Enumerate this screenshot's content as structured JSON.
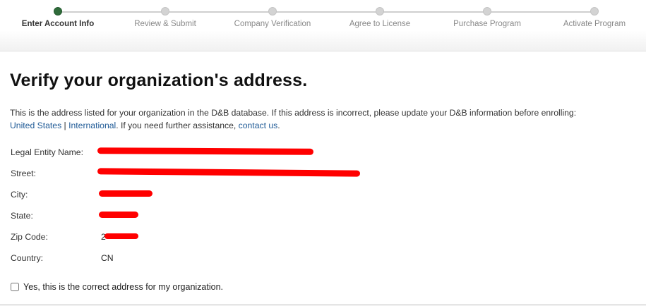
{
  "stepper": {
    "steps": [
      {
        "label": "Enter Account Info",
        "active": true
      },
      {
        "label": "Review & Submit",
        "active": false
      },
      {
        "label": "Company Verification",
        "active": false
      },
      {
        "label": "Agree to License",
        "active": false
      },
      {
        "label": "Purchase Program",
        "active": false
      },
      {
        "label": "Activate Program",
        "active": false
      }
    ]
  },
  "page": {
    "title": "Verify your organization's address.",
    "intro_text": "This is the address listed for your organization in the D&B database. If this address is incorrect, please update your D&B information before enrolling:",
    "link_us": "United States",
    "separator": " | ",
    "link_intl": "International",
    "assist_text": ". If you need further assistance, ",
    "link_contact": "contact us",
    "end_period": "."
  },
  "address": {
    "legal_entity_label": "Legal Entity Name:",
    "street_label": "Street:",
    "city_label": "City:",
    "state_label": "State:",
    "zip_label": "Zip Code:",
    "zip_visible_prefix": "2",
    "country_label": "Country:",
    "country_value": "CN"
  },
  "confirm": {
    "label": "Yes, this is the correct address for my organization.",
    "checked": false
  },
  "colors": {
    "active_step": "#2f6b3a",
    "inactive_step": "#d3d3d3",
    "link": "#1f5a96",
    "redaction": "#ff0000"
  }
}
